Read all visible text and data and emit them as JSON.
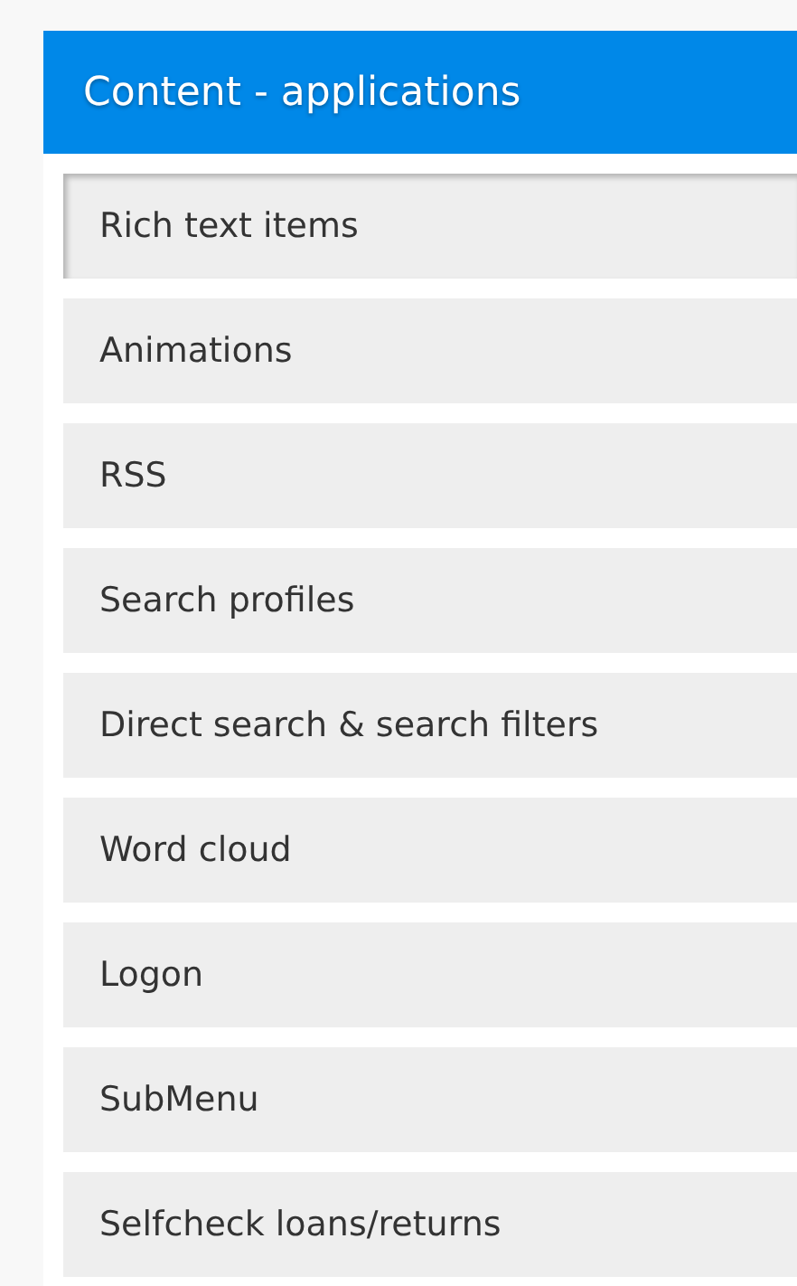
{
  "panel": {
    "title": "Content - applications"
  },
  "items": [
    {
      "label": "Rich text items",
      "selected": true
    },
    {
      "label": "Animations",
      "selected": false
    },
    {
      "label": "RSS",
      "selected": false
    },
    {
      "label": "Search profiles",
      "selected": false
    },
    {
      "label": "Direct search & search filters",
      "selected": false
    },
    {
      "label": "Word cloud",
      "selected": false
    },
    {
      "label": "Logon",
      "selected": false
    },
    {
      "label": "SubMenu",
      "selected": false
    },
    {
      "label": "Selfcheck loans/returns",
      "selected": false
    }
  ]
}
